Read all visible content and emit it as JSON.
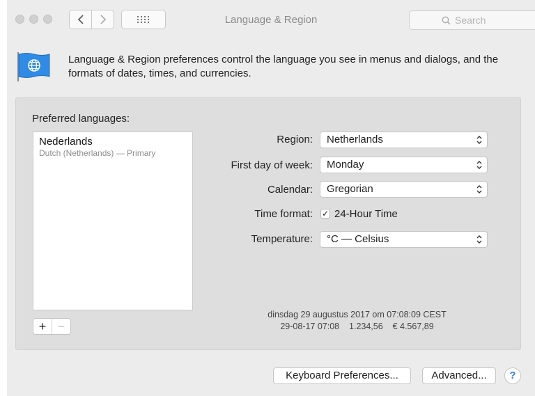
{
  "window": {
    "title": "Language & Region",
    "search_placeholder": "Search"
  },
  "header": {
    "description": "Language & Region preferences control the language you see in menus and dialogs, and the formats of dates, times, and currencies."
  },
  "languages": {
    "label": "Preferred languages:",
    "items": [
      {
        "name": "Nederlands",
        "subtitle": "Dutch (Netherlands) — Primary"
      }
    ],
    "add_label": "+",
    "remove_label": "−"
  },
  "settings": {
    "region": {
      "label": "Region:",
      "value": "Netherlands"
    },
    "first_day": {
      "label": "First day of week:",
      "value": "Monday"
    },
    "calendar": {
      "label": "Calendar:",
      "value": "Gregorian"
    },
    "time_format": {
      "label": "Time format:",
      "checkbox_label": "24-Hour Time",
      "checked": true,
      "check_glyph": "✓"
    },
    "temperature": {
      "label": "Temperature:",
      "value": "°C — Celsius"
    }
  },
  "sample": {
    "line1": "dinsdag 29 augustus 2017 om 07:08:09 CEST",
    "line2": "29-08-17 07:08    1.234,56    € 4.567,89"
  },
  "footer": {
    "keyboard_button": "Keyboard Preferences...",
    "advanced_button": "Advanced...",
    "help_label": "?"
  },
  "colors": {
    "window_bg": "#ececec",
    "panel_bg": "#dedede",
    "flag_blue": "#2f8be6",
    "help_blue": "#3a7fe0"
  }
}
